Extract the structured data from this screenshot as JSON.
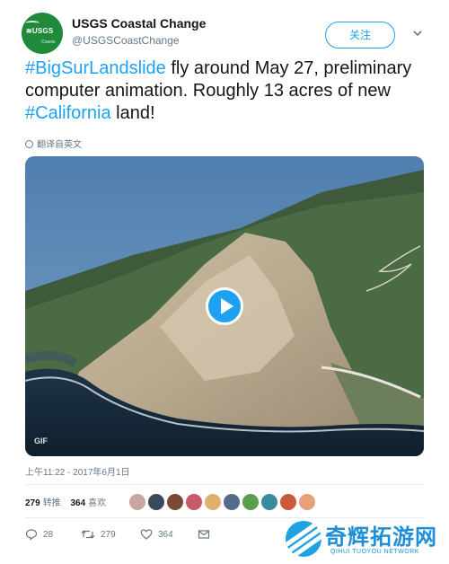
{
  "account": {
    "display_name": "USGS Coastal Change",
    "handle": "@USGSCoastChange",
    "avatar_text": "≋USGS",
    "avatar_subtext": "Coasts"
  },
  "follow_button": {
    "label": "关注"
  },
  "tweet": {
    "segments": [
      {
        "text": "#BigSurLandslide",
        "type": "hashtag"
      },
      {
        "text": " fly around May 27, preliminary computer animation. Roughly 13 acres of new ",
        "type": "text"
      },
      {
        "text": "#California",
        "type": "hashtag"
      },
      {
        "text": " land!",
        "type": "text"
      }
    ],
    "translate_label": "翻译自英文"
  },
  "media": {
    "badge": "GIF",
    "icon": "play-icon"
  },
  "timestamp": "上午11:22 - 2017年6月1日",
  "stats": {
    "retweets_count": "279",
    "retweets_label": "转推",
    "likes_count": "364",
    "likes_label": "喜欢"
  },
  "likers": [
    "#c9a7a0",
    "#3b4a5a",
    "#7a4a35",
    "#c45b6b",
    "#e0b070",
    "#556b8a",
    "#5a9e4f",
    "#3a8aa0",
    "#c85a3a",
    "#e8a07a"
  ],
  "actions": {
    "reply_count": "28",
    "retweet_count": "279",
    "like_count": "364"
  },
  "watermark": {
    "title": "奇辉拓游网",
    "subtitle": "QIHUI TUOYOU NETWORK"
  },
  "colors": {
    "accent": "#1da1f2",
    "text": "#14171a",
    "muted": "#657786",
    "avatar": "#1f8a3a"
  }
}
